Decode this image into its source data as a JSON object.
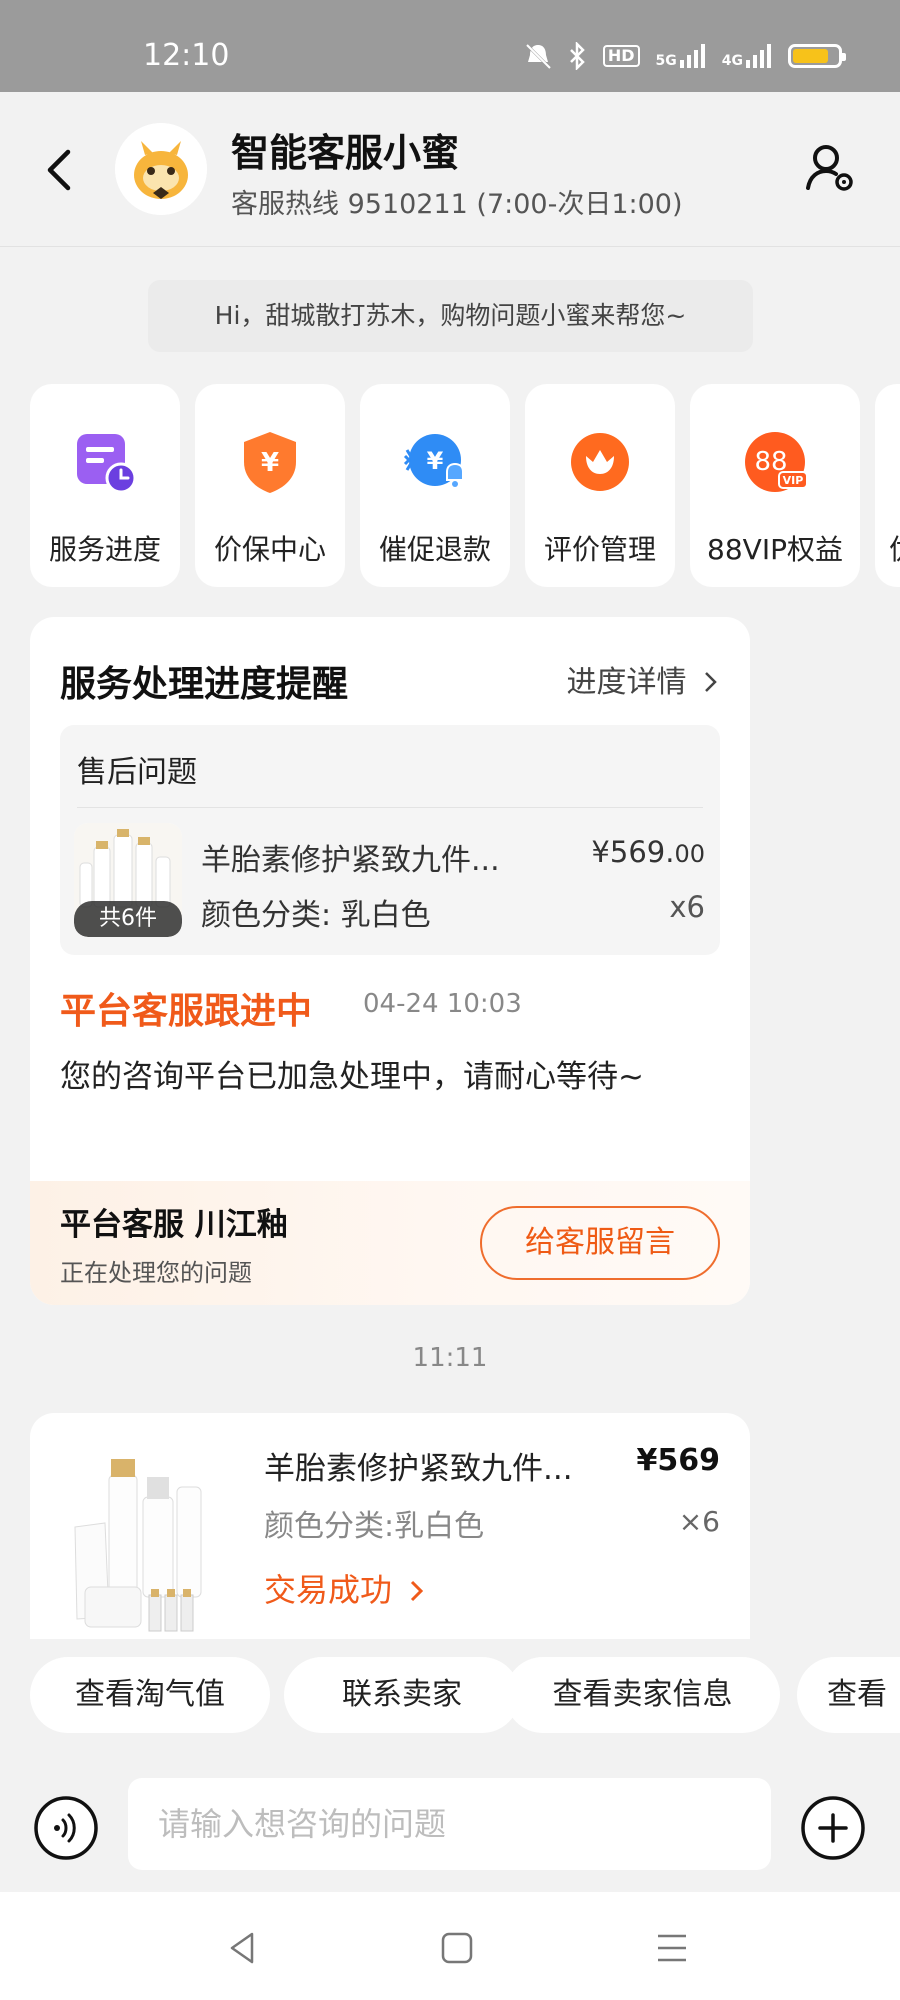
{
  "status_bar": {
    "time": "12:10",
    "hd_label": "HD",
    "net1": "5G",
    "net2": "4G",
    "battery_level": 0.8
  },
  "header": {
    "title": "智能客服小蜜",
    "hotline": "客服热线 9510211 (7:00-次日1:00)"
  },
  "welcome": "Hi，甜城散打苏木，购物问题小蜜来帮您~",
  "quick_actions": [
    {
      "label": "服务进度",
      "icon": "service-progress-icon"
    },
    {
      "label": "价保中心",
      "icon": "price-protection-icon"
    },
    {
      "label": "催促退款",
      "icon": "refund-urge-icon"
    },
    {
      "label": "评价管理",
      "icon": "review-management-icon"
    },
    {
      "label": "88VIP权益",
      "icon": "vip88-icon"
    },
    {
      "label": "优",
      "icon": "partial-icon"
    }
  ],
  "service_card": {
    "title": "服务处理进度提醒",
    "detail_link": "进度详情",
    "after_sale_title": "售后问题",
    "product": {
      "name": "羊胎素修护紧致九件...",
      "price_main": "¥569.",
      "price_decimal": "00",
      "spec": "颜色分类: 乳白色",
      "qty": "x6",
      "count_badge": "共6件"
    },
    "follow_status": "平台客服跟进中",
    "follow_time": "04-24 10:03",
    "follow_message": "您的咨询平台已加急处理中，请耐心等待~",
    "agent_name": "平台客服 川江釉",
    "agent_sub": "正在处理您的问题",
    "leave_message_button": "给客服留言"
  },
  "time_separator": "11:11",
  "order_card": {
    "name": "羊胎素修护紧致九件...",
    "price": "¥569",
    "spec": "颜色分类:乳白色",
    "qty": "×6",
    "status": "交易成功"
  },
  "chips": [
    "查看淘气值",
    "联系卖家",
    "查看卖家信息",
    "查看"
  ],
  "input": {
    "placeholder": "请输入想咨询的问题"
  },
  "colors": {
    "accent_orange": "#f05a1a",
    "status_bar": "#9b9b9b",
    "page_bg": "#f2f2f2"
  }
}
